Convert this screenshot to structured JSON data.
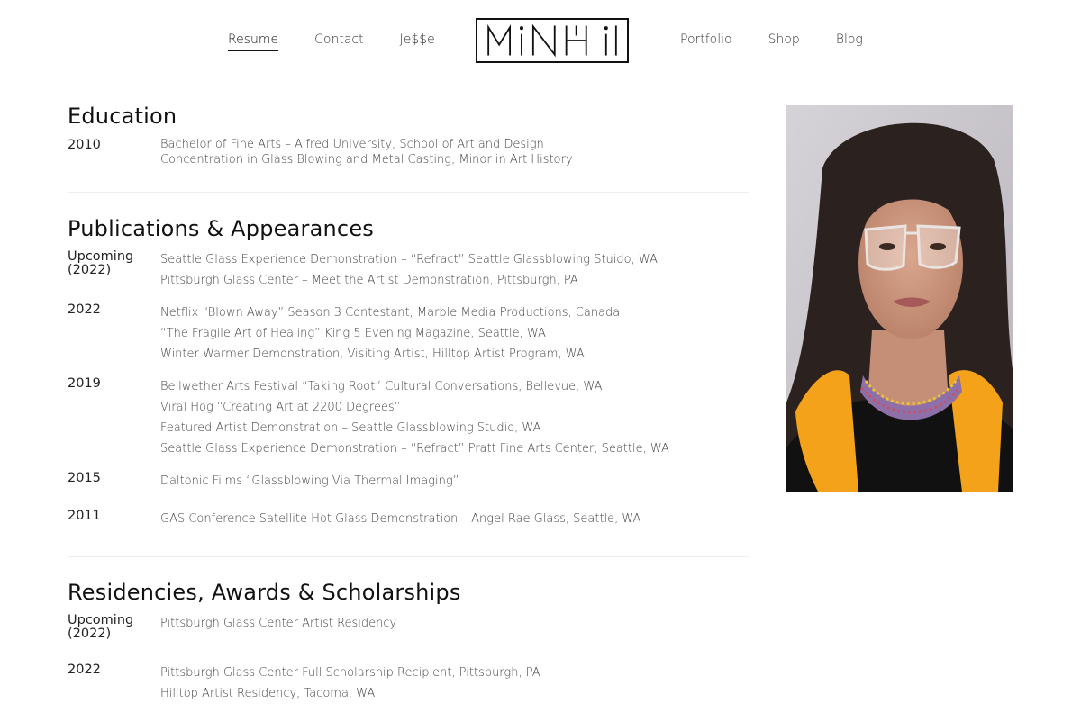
{
  "nav": {
    "left": [
      {
        "label": "Resume",
        "active": true
      },
      {
        "label": "Contact",
        "active": false
      },
      {
        "label": "Je$$e",
        "active": false
      }
    ],
    "right": [
      {
        "label": "Portfolio",
        "active": false
      },
      {
        "label": "Shop",
        "active": false
      },
      {
        "label": "Blog",
        "active": false
      }
    ],
    "logo_text": "MiNHi"
  },
  "education": {
    "title": "Education",
    "entries": [
      {
        "year": "2010",
        "items": [
          "Bachelor of Fine Arts – Alfred University, School of Art and Design",
          "Concentration in Glass Blowing and Metal Casting, Minor in Art History"
        ]
      }
    ]
  },
  "publications": {
    "title": "Publications & Appearances",
    "entries": [
      {
        "year": "Upcoming (2022)",
        "items": [
          "Seattle Glass Experience Demonstration – “Refract” Seattle Glassblowing Stuido, WA",
          "Pittsburgh Glass Center – Meet the Artist Demonstration, Pittsburgh, PA"
        ]
      },
      {
        "year": "2022",
        "items": [
          "Netflix “Blown Away” Season 3 Contestant, Marble Media Productions, Canada",
          "“The Fragile Art of Healing” King 5 Evening Magazine, Seattle, WA",
          "Winter Warmer Demonstration, Visiting Artist, Hilltop Artist Program, WA"
        ]
      },
      {
        "year": "2019",
        "items": [
          "Bellwether Arts Festival “Taking Root” Cultural Conversations, Bellevue, WA",
          "Viral Hog “Creating Art at 2200 Degrees”",
          "Featured Artist Demonstration – Seattle Glassblowing Studio, WA",
          "Seattle Glass Experience Demonstration – “Refract” Pratt Fine Arts Center, Seattle, WA"
        ]
      },
      {
        "year": "2015",
        "items": [
          "Daltonic Films “Glassblowing Via Thermal Imaging”"
        ]
      },
      {
        "year": "2011",
        "items": [
          "GAS Conference Satellite Hot Glass Demonstration – Angel Rae Glass, Seattle, WA"
        ]
      }
    ]
  },
  "residencies": {
    "title": "Residencies, Awards & Scholarships",
    "entries": [
      {
        "year": "Upcoming (2022)",
        "items": [
          "Pittsburgh Glass Center Artist Residency"
        ]
      },
      {
        "year": "2022",
        "items": [
          "Pittsburgh Glass Center Full Scholarship Recipient, Pittsburgh, PA",
          "Hilltop Artist Residency, Tacoma, WA"
        ]
      }
    ]
  },
  "colors": {
    "accent_scarf": "#f3a21a",
    "text_dark": "#111111",
    "text_body": "#444444",
    "divider": "#eeeeee"
  }
}
